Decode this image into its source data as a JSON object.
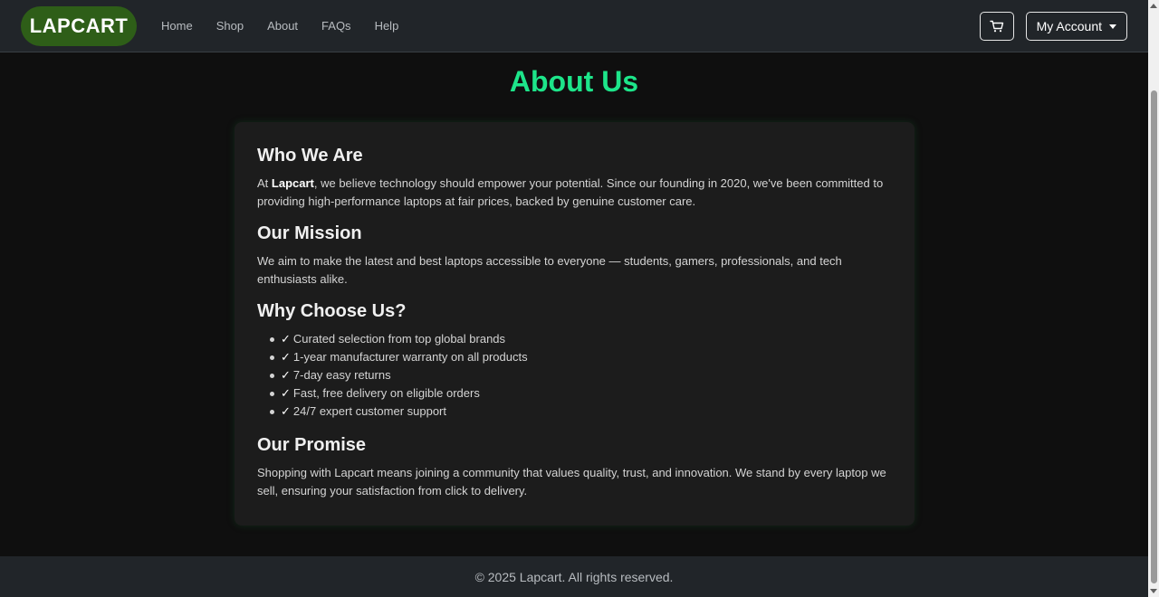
{
  "navbar": {
    "brand": "LAPCART",
    "links": [
      "Home",
      "Shop",
      "About",
      "FAQs",
      "Help"
    ],
    "account_label": "My Account"
  },
  "page": {
    "title": "About Us"
  },
  "sections": {
    "who": {
      "heading": "Who We Are",
      "text_before": "At ",
      "brand_bold": "Lapcart",
      "text_after": ", we believe technology should empower your potential. Since our founding in 2020, we've been committed to providing high-performance laptops at fair prices, backed by genuine customer care."
    },
    "mission": {
      "heading": "Our Mission",
      "text": "We aim to make the latest and best laptops accessible to everyone — students, gamers, professionals, and tech enthusiasts alike."
    },
    "why": {
      "heading": "Why Choose Us?",
      "check": "✓",
      "items": [
        "Curated selection from top global brands",
        "1-year manufacturer warranty on all products",
        "7-day easy returns",
        "Fast, free delivery on eligible orders",
        "24/7 expert customer support"
      ]
    },
    "promise": {
      "heading": "Our Promise",
      "text": "Shopping with Lapcart means joining a community that values quality, trust, and innovation. We stand by every laptop we sell, ensuring your satisfaction from click to delivery."
    }
  },
  "footer": {
    "text": "© 2025 Lapcart. All rights reserved."
  },
  "colors": {
    "accent": "#1de58a",
    "brand_pill": "#2e5e18",
    "navbar_bg": "#212529",
    "page_bg": "#0f0f0f",
    "card_bg": "#1c1c1c"
  },
  "icons": {
    "cart": "shopping-cart-icon",
    "caret": "caret-down-icon",
    "bullet_check": "check-icon"
  }
}
